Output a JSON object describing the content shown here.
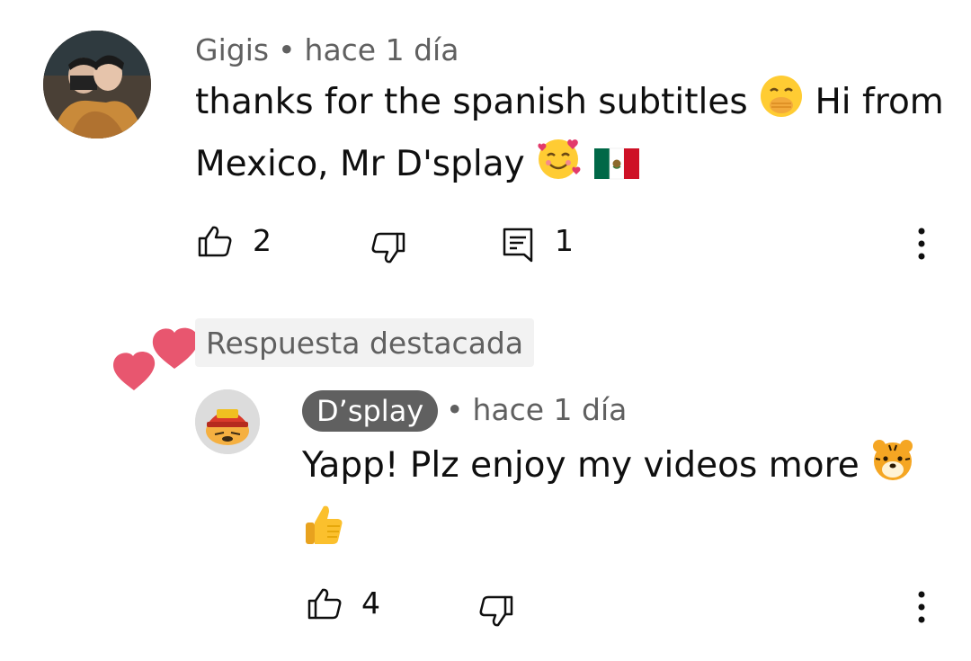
{
  "comment": {
    "author": "Gigis",
    "separator": "•",
    "time": "hace 1 día",
    "text_line1": "thanks for the spanish subtitles",
    "text_line1_after": "Hi from",
    "text_line2": "Mexico, Mr D'splay",
    "likes": "2",
    "replies": "1",
    "icons": [
      "thumbs-up-icon",
      "thumbs-down-icon",
      "reply-icon",
      "more-vert-icon",
      "hand-over-mouth-emoji",
      "smiling-hearts-emoji",
      "mexico-flag-emoji"
    ]
  },
  "reply": {
    "badge": "Respuesta destacada",
    "author": "D’splay",
    "separator": "•",
    "time": "hace 1 día",
    "text_line1": "Yapp! Plz enjoy my videos more",
    "likes": "4",
    "icons": [
      "hearts-icon",
      "tiger-avatar",
      "tiger-face-emoji",
      "thumbs-up-emoji",
      "thumbs-up-icon",
      "thumbs-down-icon",
      "more-vert-icon"
    ]
  },
  "colors": {
    "text_primary": "#0f0f0f",
    "text_secondary": "#606060",
    "heart": "#e8566f",
    "badge_bg": "#f2f2f2",
    "pill_bg": "#606060"
  }
}
